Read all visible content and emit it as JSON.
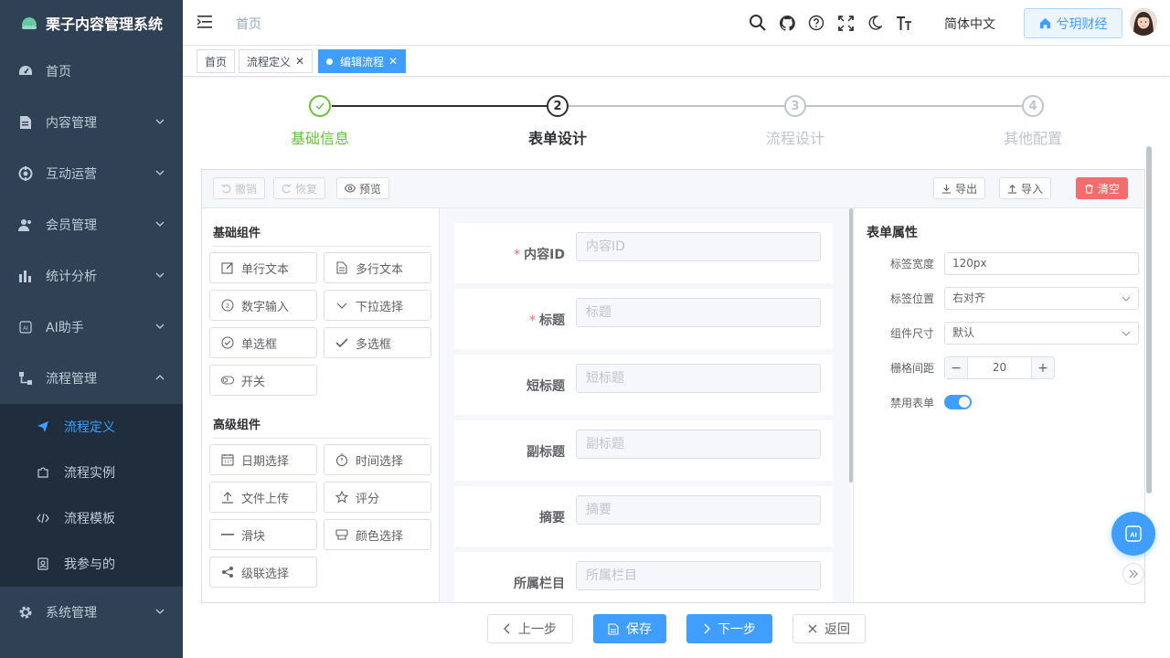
{
  "app": {
    "title": "栗子内容管理系统"
  },
  "sidebar": {
    "items": [
      {
        "label": "首页",
        "icon": "dashboard-icon",
        "has_children": false
      },
      {
        "label": "内容管理",
        "icon": "document-icon",
        "has_children": true
      },
      {
        "label": "互动运营",
        "icon": "interaction-icon",
        "has_children": true
      },
      {
        "label": "会员管理",
        "icon": "members-icon",
        "has_children": true
      },
      {
        "label": "统计分析",
        "icon": "chart-icon",
        "has_children": true
      },
      {
        "label": "AI助手",
        "icon": "ai-icon",
        "has_children": true
      },
      {
        "label": "流程管理",
        "icon": "workflow-icon",
        "has_children": true,
        "expanded": true
      }
    ],
    "workflow_children": [
      {
        "label": "流程定义",
        "icon": "send-icon",
        "active": true
      },
      {
        "label": "流程实例",
        "icon": "puzzle-icon",
        "active": false
      },
      {
        "label": "流程模板",
        "icon": "code-icon",
        "active": false
      },
      {
        "label": "我参与的",
        "icon": "user-card-icon",
        "active": false
      }
    ],
    "after_items": [
      {
        "label": "系统管理",
        "icon": "gear-icon",
        "has_children": true
      }
    ]
  },
  "navbar": {
    "breadcrumb": "首页",
    "language": "简体中文",
    "org_button": "兮玥财经",
    "icons": [
      "search-icon",
      "github-icon",
      "help-icon",
      "fullscreen-icon",
      "dark-mode-icon",
      "font-size-icon"
    ]
  },
  "tags": [
    {
      "label": "首页",
      "closable": false,
      "active": false
    },
    {
      "label": "流程定义",
      "closable": true,
      "active": false
    },
    {
      "label": "编辑流程",
      "closable": true,
      "active": true
    }
  ],
  "steps": {
    "current_index": 1,
    "items": [
      {
        "number": "1",
        "label": "基础信息",
        "status": "done"
      },
      {
        "number": "2",
        "label": "表单设计",
        "status": "current"
      },
      {
        "number": "3",
        "label": "流程设计",
        "status": "wait"
      },
      {
        "number": "4",
        "label": "其他配置",
        "status": "wait"
      }
    ]
  },
  "toolbar": {
    "undo": "撤销",
    "redo": "恢复",
    "preview": "预览",
    "export": "导出",
    "import": "导入",
    "clear": "清空"
  },
  "palette": {
    "basic_title": "基础组件",
    "basic": [
      {
        "label": "单行文本",
        "icon": "edit-icon"
      },
      {
        "label": "多行文本",
        "icon": "document-icon"
      },
      {
        "label": "数字输入",
        "icon": "number-icon"
      },
      {
        "label": "下拉选择",
        "icon": "chevron-down-icon"
      },
      {
        "label": "单选框",
        "icon": "radio-check-icon"
      },
      {
        "label": "多选框",
        "icon": "check-icon"
      },
      {
        "label": "开关",
        "icon": "toggle-icon"
      }
    ],
    "advanced_title": "高级组件",
    "advanced": [
      {
        "label": "日期选择",
        "icon": "calendar-icon"
      },
      {
        "label": "时间选择",
        "icon": "stopwatch-icon"
      },
      {
        "label": "文件上传",
        "icon": "upload-icon"
      },
      {
        "label": "评分",
        "icon": "star-icon"
      },
      {
        "label": "滑块",
        "icon": "slider-icon"
      },
      {
        "label": "颜色选择",
        "icon": "palette-icon"
      },
      {
        "label": "级联选择",
        "icon": "share-icon"
      }
    ]
  },
  "form_fields": [
    {
      "label": "内容ID",
      "placeholder": "内容ID",
      "required": true
    },
    {
      "label": "标题",
      "placeholder": "标题",
      "required": true
    },
    {
      "label": "短标题",
      "placeholder": "短标题",
      "required": false
    },
    {
      "label": "副标题",
      "placeholder": "副标题",
      "required": false
    },
    {
      "label": "摘要",
      "placeholder": "摘要",
      "required": false
    },
    {
      "label": "所属栏目",
      "placeholder": "所属栏目",
      "required": false
    }
  ],
  "properties": {
    "title": "表单属性",
    "label_width": {
      "label": "标签宽度",
      "value": "120px"
    },
    "label_position": {
      "label": "标签位置",
      "value": "右对齐"
    },
    "component_size": {
      "label": "组件尺寸",
      "value": "默认"
    },
    "gutter": {
      "label": "栅格间距",
      "value": "20"
    },
    "disabled": {
      "label": "禁用表单",
      "value": true
    }
  },
  "footer": {
    "prev": "上一步",
    "save": "保存",
    "next": "下一步",
    "back": "返回"
  },
  "colors": {
    "primary": "#409eff",
    "success": "#67c23a",
    "danger": "#f56c6c",
    "sidebar_bg": "#304156",
    "submenu_bg": "#1f2d3d"
  }
}
